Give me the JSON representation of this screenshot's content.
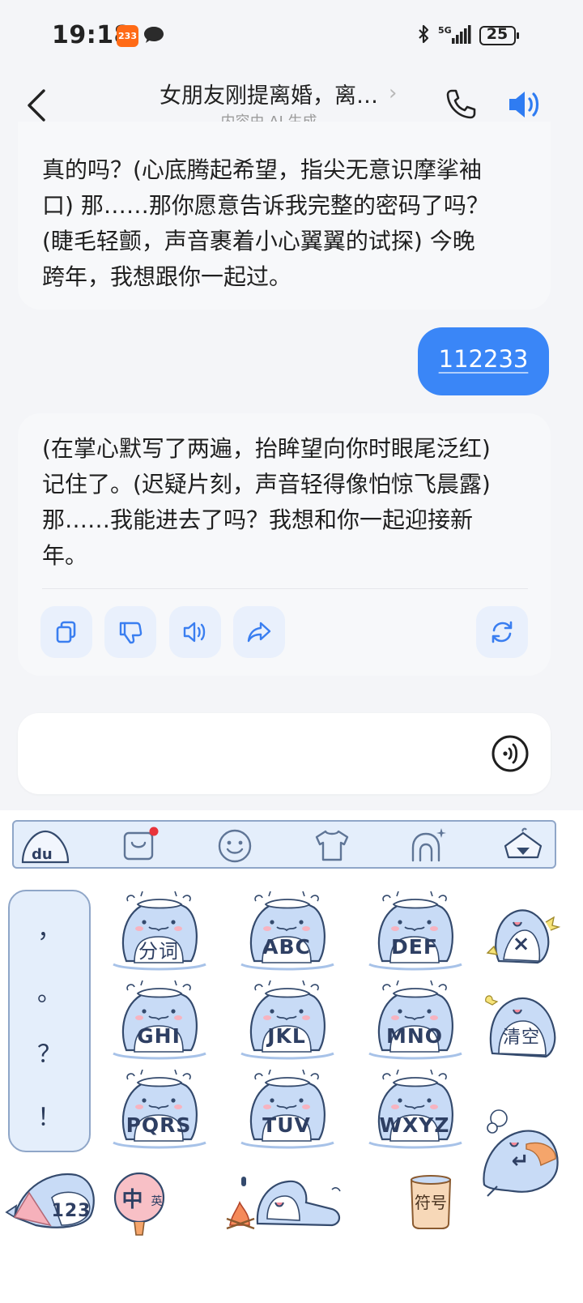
{
  "status_bar": {
    "time": "19:18",
    "app_badge": "233",
    "network": "5G",
    "battery": "25"
  },
  "header": {
    "title": "女朋友刚提离婚，离…",
    "chevron": "›",
    "subtitle": "内容由 AI 生成"
  },
  "messages": [
    {
      "role": "ai",
      "lines": [
        "真的吗？(心底腾起希望，指尖无意识摩挲袖",
        "口) 那……那你愿意告诉我完整的密码了吗？",
        "(睫毛轻颤，声音裹着小心翼翼的试探) 今晚",
        "跨年，我想跟你一起过。"
      ]
    },
    {
      "role": "user",
      "text": "112233"
    },
    {
      "role": "ai",
      "lines": [
        "(在掌心默写了两遍，抬眸望向你时眼尾泛红)",
        "记住了。(迟疑片刻，声音轻得像怕惊飞晨露)",
        "那……我能进去了吗？我想和你一起迎接新",
        "年。"
      ]
    }
  ],
  "actions": [
    "copy-icon",
    "dislike-icon",
    "read-aloud-icon",
    "share-icon",
    "regenerate-icon"
  ],
  "keyboard": {
    "toolbar_logo": "du",
    "toolbar_icons": [
      "store-icon",
      "emoji-icon",
      "skin-icon",
      "ai-assistant-icon",
      "hide-keyboard-icon"
    ],
    "punctuation": [
      "，",
      "。",
      "？",
      "！"
    ],
    "keys": [
      [
        "分词",
        "ABC",
        "DEF"
      ],
      [
        "GHI",
        "JKL",
        "MNO"
      ],
      [
        "PQRS",
        "TUV",
        "WXYZ"
      ]
    ],
    "delete_label": "×",
    "clear_label": "清空",
    "enter_label": "↵",
    "numbers_label": "123",
    "lang_label_main": "中",
    "lang_label_sub": "英",
    "symbols_label": "符号"
  },
  "colors": {
    "accent": "#3a86f7",
    "bubble_ai": "#f7f8fa",
    "keyboard_outline": "#8fa6c8",
    "keyboard_fill": "#e4eefb"
  }
}
